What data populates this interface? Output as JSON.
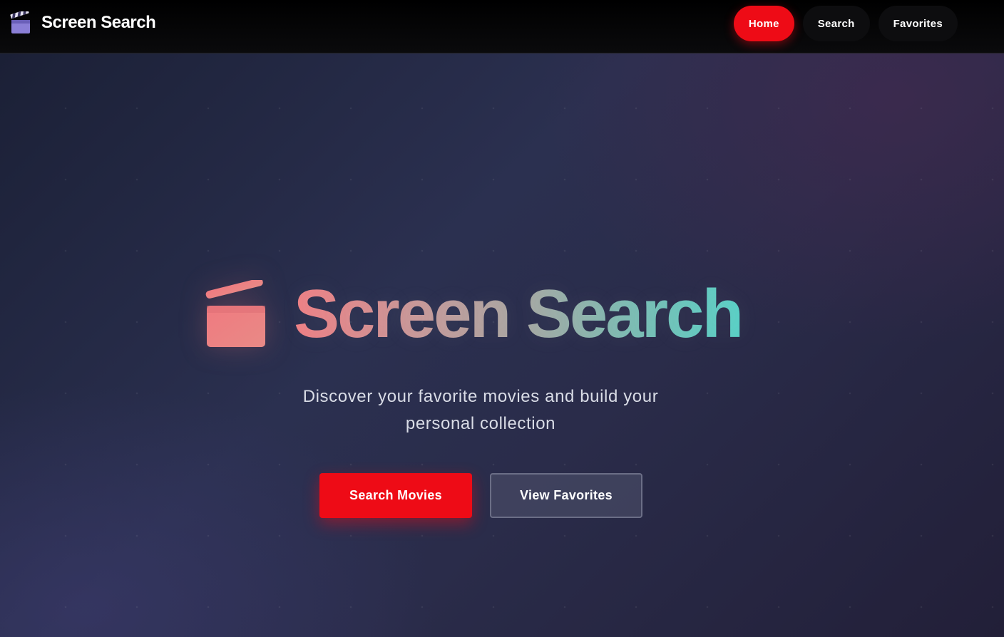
{
  "navbar": {
    "brand_icon": "clapperboard-icon",
    "brand_title": "Screen Search",
    "links": [
      {
        "label": "Home",
        "active": true
      },
      {
        "label": "Search",
        "active": false
      },
      {
        "label": "Favorites",
        "active": false
      }
    ]
  },
  "hero": {
    "icon": "clapperboard-icon",
    "title": "Screen Search",
    "subtitle": "Discover your favorite movies and build your personal collection",
    "primary_button": "Search Movies",
    "secondary_button": "View Favorites"
  },
  "colors": {
    "accent": "#ee0b16",
    "title_gradient_start": "#ef7f84",
    "title_gradient_end": "#58d0c6",
    "navbar_bg": "#000000"
  }
}
